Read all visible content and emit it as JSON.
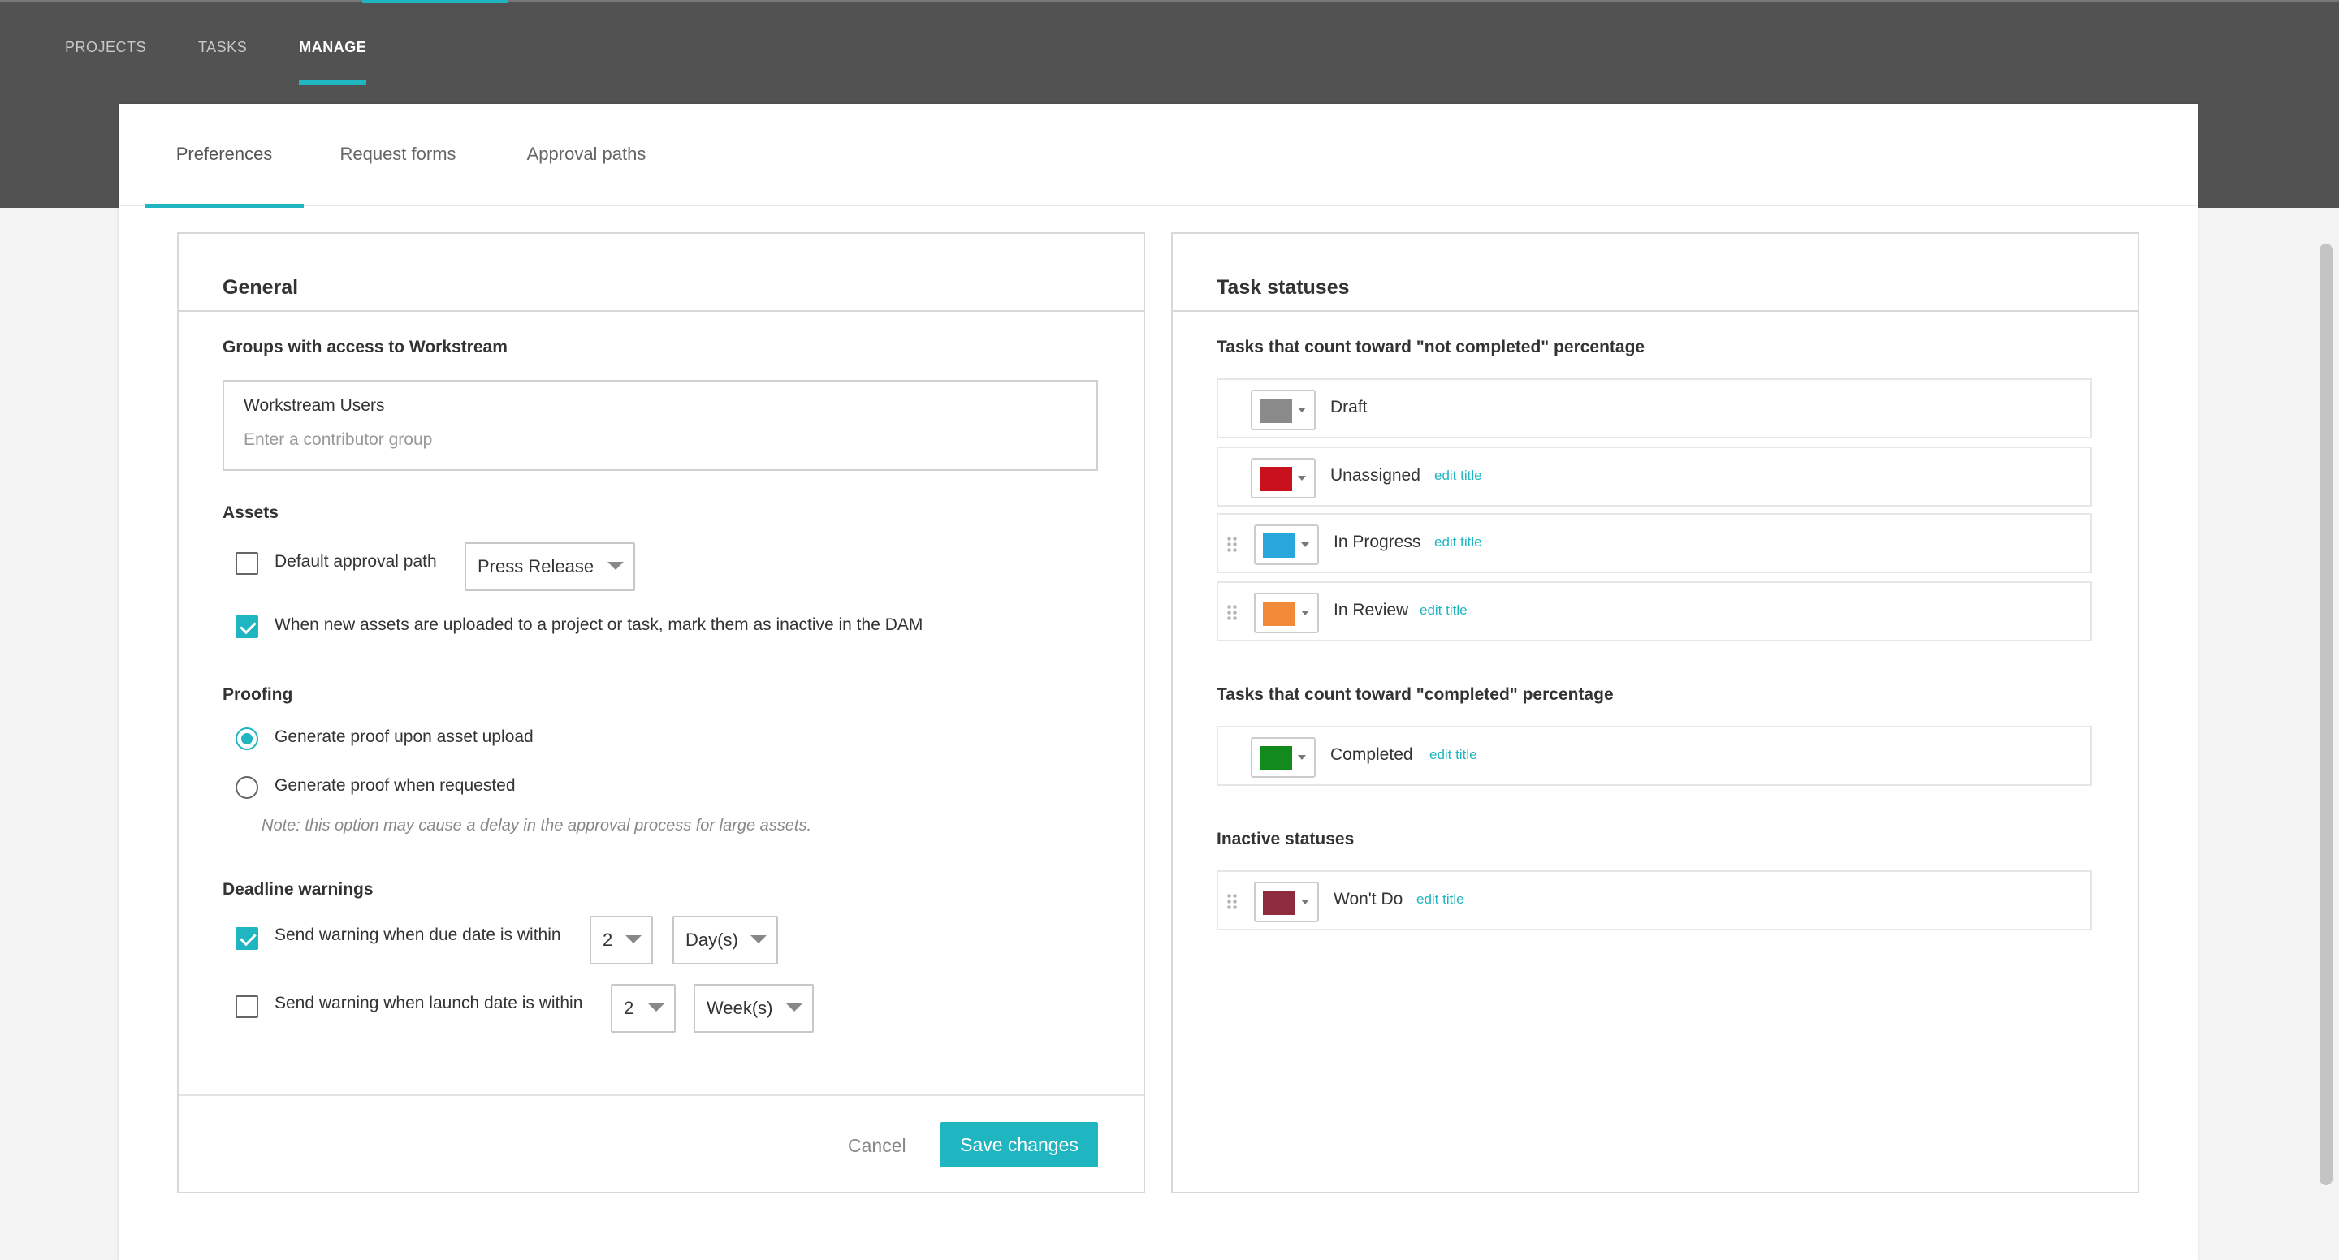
{
  "nav": {
    "items": [
      {
        "label": "PROJECTS",
        "active": false
      },
      {
        "label": "TASKS",
        "active": false
      },
      {
        "label": "MANAGE",
        "active": true
      }
    ]
  },
  "subtabs": [
    {
      "label": "Preferences",
      "active": true
    },
    {
      "label": "Request forms",
      "active": false
    },
    {
      "label": "Approval paths",
      "active": false
    }
  ],
  "general": {
    "title": "General",
    "groups": {
      "label": "Groups with access to Workstream",
      "chip": "Workstream Users",
      "placeholder": "Enter a contributor group"
    },
    "assets": {
      "label": "Assets",
      "default_approval_label": "Default approval path",
      "default_approval_checked": false,
      "default_approval_value": "Press Release",
      "inactive_label": "When new assets are uploaded to a project or task, mark them as inactive in the DAM",
      "inactive_checked": true
    },
    "proofing": {
      "label": "Proofing",
      "option_upload": "Generate proof upon asset upload",
      "option_requested": "Generate proof when requested",
      "selected": "upload",
      "note": "Note: this option may cause a delay in the approval process for large assets."
    },
    "deadline": {
      "label": "Deadline warnings",
      "due_label": "Send warning when due date is within",
      "due_checked": true,
      "due_number": "2",
      "due_unit": "Day(s)",
      "launch_label": "Send warning when launch date is within",
      "launch_checked": false,
      "launch_number": "2",
      "launch_unit": "Week(s)"
    },
    "cancel_label": "Cancel",
    "save_label": "Save changes"
  },
  "task_statuses": {
    "title": "Task statuses",
    "not_completed_label": "Tasks that count toward \"not completed\" percentage",
    "completed_label": "Tasks that count toward \"completed\" percentage",
    "inactive_label": "Inactive statuses",
    "edit_label": "edit title",
    "not_completed": [
      {
        "name": "Draft",
        "color": "#8a8a8a",
        "editable": false,
        "draggable": false
      },
      {
        "name": "Unassigned",
        "color": "#c8101e",
        "editable": true,
        "draggable": false
      },
      {
        "name": "In Progress",
        "color": "#27a7dc",
        "editable": true,
        "draggable": true
      },
      {
        "name": "In Review",
        "color": "#f08a38",
        "editable": true,
        "draggable": true
      }
    ],
    "completed": [
      {
        "name": "Completed",
        "color": "#138a1c",
        "editable": true,
        "draggable": false
      }
    ],
    "inactive": [
      {
        "name": "Won't Do",
        "color": "#8e2b3f",
        "editable": true,
        "draggable": true
      }
    ]
  },
  "colors": {
    "accent": "#1fb5c1",
    "topbar": "#525252"
  }
}
